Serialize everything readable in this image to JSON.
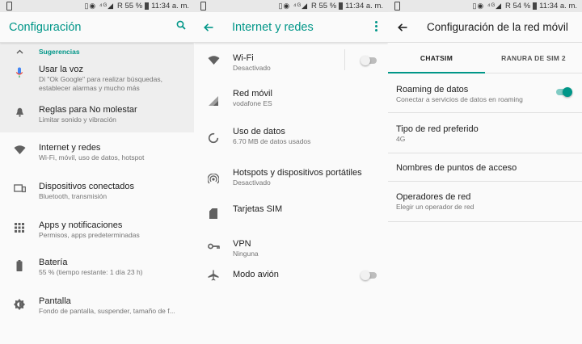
{
  "colors": {
    "accent": "#009688",
    "text": "#212121",
    "secondary": "#757575",
    "background": "#fafafa"
  },
  "status": {
    "battery_1": "55 %",
    "battery_2": "55 %",
    "battery_3": "54 %",
    "time": "11:34 a. m.",
    "network": "4G",
    "roaming": "R"
  },
  "settings": {
    "title": "Configuración",
    "suggestions_label": "Sugerencias",
    "suggestions": [
      {
        "title": "Usar la voz",
        "sub": "Di \"Ok Google\" para realizar búsquedas, establecer alarmas y mucho más",
        "icon": "mic-icon"
      },
      {
        "title": "Reglas para No molestar",
        "sub": "Limitar sonido y vibración",
        "icon": "bell-icon"
      }
    ],
    "items": [
      {
        "title": "Internet y redes",
        "sub": "Wi-Fi, móvil, uso de datos, hotspot",
        "icon": "wifi-icon"
      },
      {
        "title": "Dispositivos conectados",
        "sub": "Bluetooth, transmisión",
        "icon": "devices-icon"
      },
      {
        "title": "Apps y notificaciones",
        "sub": "Permisos, apps predeterminadas",
        "icon": "apps-icon"
      },
      {
        "title": "Batería",
        "sub": "55 % (tiempo restante: 1 día 23 h)",
        "icon": "battery-icon"
      },
      {
        "title": "Pantalla",
        "sub": "Fondo de pantalla, suspender, tamaño de f...",
        "icon": "brightness-icon"
      }
    ]
  },
  "network": {
    "title": "Internet y redes",
    "items": [
      {
        "title": "Wi-Fi",
        "sub": "Desactivado",
        "icon": "wifi-icon",
        "toggle": false
      },
      {
        "title": "Red móvil",
        "sub": "vodafone ES",
        "icon": "signal-icon"
      },
      {
        "title": "Uso de datos",
        "sub": "6.70 MB de datos usados",
        "icon": "data-usage-icon"
      },
      {
        "title": "Hotspots y dispositivos portátiles",
        "sub": "Desactivado",
        "icon": "hotspot-icon"
      },
      {
        "title": "Tarjetas SIM",
        "sub": "",
        "icon": "sim-icon"
      },
      {
        "title": "VPN",
        "sub": "Ninguna",
        "icon": "key-icon"
      },
      {
        "title": "Modo avión",
        "sub": "",
        "icon": "airplane-icon",
        "toggle": false
      }
    ]
  },
  "mobile": {
    "title": "Configuración de la red móvil",
    "tabs": [
      "CHATSIM",
      "RANURA DE SIM 2"
    ],
    "active_tab": 0,
    "items": [
      {
        "title": "Roaming de datos",
        "sub": "Conectar a servicios de datos en roaming",
        "toggle": true
      },
      {
        "title": "Tipo de red preferido",
        "sub": "4G"
      },
      {
        "title": "Nombres de puntos de acceso",
        "sub": ""
      },
      {
        "title": "Operadores de red",
        "sub": "Elegir un operador de red"
      }
    ]
  }
}
